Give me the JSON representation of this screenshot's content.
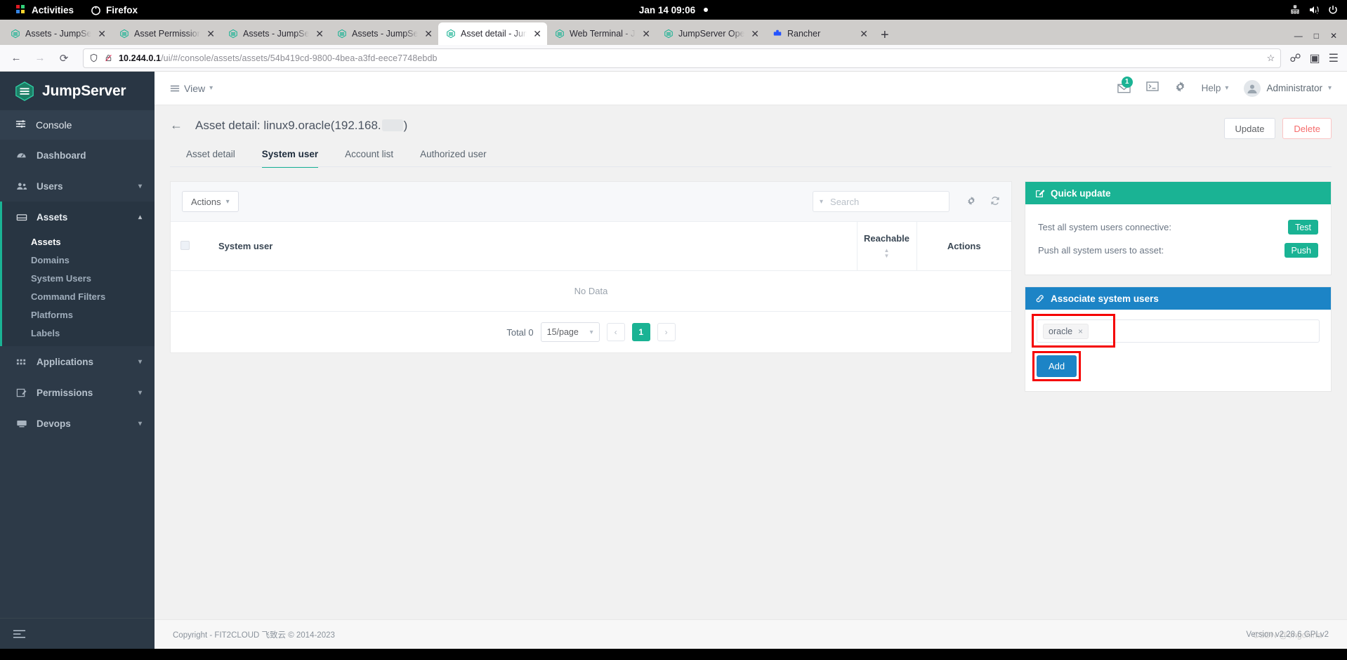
{
  "gnome": {
    "activities": "Activities",
    "app": "Firefox",
    "clock": "Jan 14  09:06",
    "tray": [
      "network-icon",
      "volume-muted-icon",
      "power-icon"
    ]
  },
  "browser": {
    "tabs": [
      {
        "label": "Assets - JumpServer Open Source...",
        "icon": "jumpserver-favicon",
        "active": false
      },
      {
        "label": "Asset Permissions - JumpServer...",
        "icon": "jumpserver-favicon",
        "active": false
      },
      {
        "label": "Assets - JumpServer Open Source...",
        "icon": "jumpserver-favicon",
        "active": false
      },
      {
        "label": "Assets - JumpServer Open Source...",
        "icon": "jumpserver-favicon",
        "active": false
      },
      {
        "label": "Asset detail - JumpServer Open...",
        "icon": "jumpserver-favicon",
        "active": true
      },
      {
        "label": "Web Terminal - JumpServer Open...",
        "icon": "jumpserver-favicon",
        "active": false
      },
      {
        "label": "JumpServer Open Source Bastion...",
        "icon": "jumpserver-favicon",
        "active": false
      },
      {
        "label": "Rancher",
        "icon": "rancher-favicon",
        "active": false
      }
    ],
    "newtab_label": "+",
    "url_host": "10.244.0.1",
    "url_path": "/ui/#/console/assets/assets/54b419cd-9800-4bea-a3fd-eece7748ebdb",
    "close_glyph": "✕"
  },
  "sidebar": {
    "brand": "JumpServer",
    "console": "Console",
    "items": [
      {
        "label": "Dashboard",
        "icon": "dashboard-icon",
        "expandable": false
      },
      {
        "label": "Users",
        "icon": "users-icon",
        "expandable": true
      },
      {
        "label": "Assets",
        "icon": "assets-icon",
        "expandable": true,
        "open": true
      },
      {
        "label": "Applications",
        "icon": "grid-icon",
        "expandable": true
      },
      {
        "label": "Permissions",
        "icon": "permissions-icon",
        "expandable": true
      },
      {
        "label": "Devops",
        "icon": "devops-icon",
        "expandable": true
      }
    ],
    "assets_sub": [
      {
        "label": "Assets",
        "active": true
      },
      {
        "label": "Domains",
        "active": false
      },
      {
        "label": "System Users",
        "active": false
      },
      {
        "label": "Command Filters",
        "active": false
      },
      {
        "label": "Platforms",
        "active": false
      },
      {
        "label": "Labels",
        "active": false
      }
    ],
    "collapse_icon": "collapse-menu-icon"
  },
  "topbar": {
    "view_label": "View",
    "mail_badge": "1",
    "help_label": "Help",
    "user_label": "Administrator",
    "icons": [
      "mail-icon",
      "terminal-icon",
      "gear-icon"
    ]
  },
  "page": {
    "title_prefix": "Asset detail:",
    "title_value": "linux9.oracle(192.168.",
    "title_suffix": ")",
    "update_label": "Update",
    "delete_label": "Delete",
    "tabs": [
      {
        "label": "Asset detail",
        "active": false
      },
      {
        "label": "System user",
        "active": true
      },
      {
        "label": "Account list",
        "active": false
      },
      {
        "label": "Authorized user",
        "active": false
      }
    ]
  },
  "table": {
    "actions_label": "Actions",
    "search_placeholder": "Search",
    "columns": [
      "System user",
      "Reachable",
      "Actions"
    ],
    "empty_text": "No Data",
    "total_label": "Total 0",
    "page_size": "15/page",
    "current_page": "1",
    "prev_glyph": "‹",
    "next_glyph": "›"
  },
  "quick_update": {
    "title": "Quick update",
    "icon": "edit-square-icon",
    "rows": [
      {
        "label": "Test all system users connective:",
        "button": "Test"
      },
      {
        "label": "Push all system users to asset:",
        "button": "Push"
      }
    ]
  },
  "associate": {
    "title": "Associate system users",
    "icon": "link-icon",
    "chips": [
      {
        "label": "oracle",
        "remove": "×"
      }
    ],
    "add_label": "Add",
    "highlight_color": "#f50000"
  },
  "footer": {
    "copyright": "Copyright - FIT2CLOUD 飞致云 © 2014-2023",
    "version": "Version v2.28.6 GPLv2",
    "watermark": "CSDN @ongchina"
  },
  "colors": {
    "brand_green": "#1ab394",
    "panel_blue": "#1c84c6",
    "sidebar_bg": "#2d3a48",
    "danger": "#f56c6c"
  }
}
